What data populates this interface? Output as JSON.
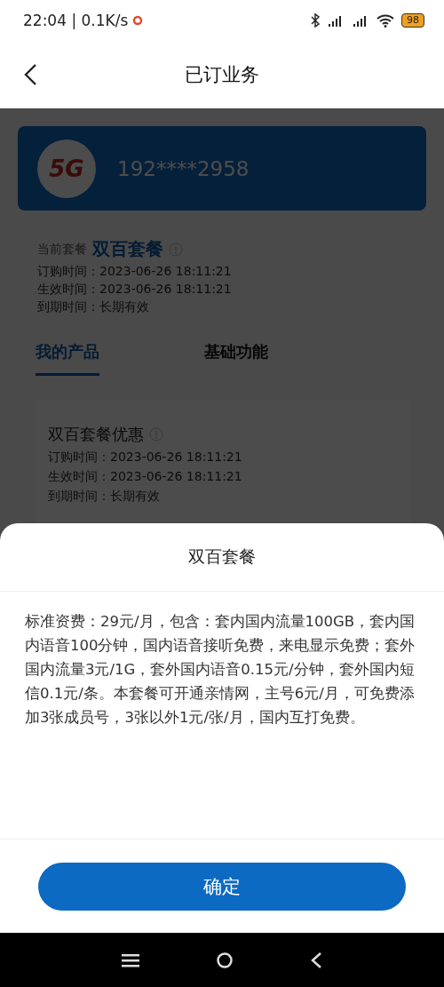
{
  "status_bar": {
    "time": "22:04 | 0.1K/s",
    "battery": "98"
  },
  "header": {
    "title": "已订业务"
  },
  "account": {
    "logo": "5G",
    "phone": "192****2958"
  },
  "current_plan": {
    "label": "当前套餐",
    "name": "双百套餐",
    "details": [
      "订购时间：2023-06-26 18:11:21",
      "生效时间：2023-06-26 18:11:21",
      "到期时间：长期有效"
    ]
  },
  "tabs": [
    {
      "label": "我的产品",
      "selected": true
    },
    {
      "label": "基础功能",
      "selected": false
    }
  ],
  "products": [
    {
      "name": "双百套餐优惠",
      "details": [
        "订购时间：2023-06-26 18:11:21",
        "生效时间：2023-06-26 18:11:21",
        "到期时间：长期有效"
      ]
    }
  ],
  "sheet": {
    "title": "双百套餐",
    "body": "标准资费：29元/月，包含：套内国内流量100GB，套内国内语音100分钟，国内语音接听免费，来电显示免费；套外国内流量3元/1G，套外国内语音0.15元/分钟，套外国内短信0.1元/条。本套餐可开通亲情网，主号6元/月，可免费添加3张成员号，3张以外1元/张/月，国内互打免费。",
    "button": "确定"
  }
}
